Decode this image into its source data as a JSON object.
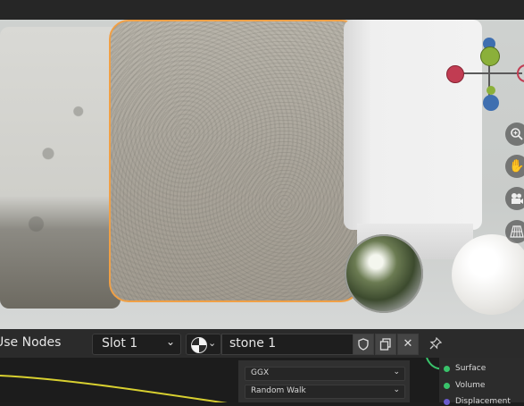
{
  "header": {
    "use_nodes_label": "Use Nodes",
    "slot_label": "Slot 1",
    "material_name": "stone 1"
  },
  "node": {
    "distribution": "GGX",
    "subsurface_method": "Random Walk"
  },
  "output_sockets": [
    "Surface",
    "Volume",
    "Displacement"
  ],
  "colors": {
    "selection_outline": "#f0a046",
    "axis_x": "#c13c52",
    "axis_y": "#8bb03a",
    "axis_z": "#3f6fb0",
    "link_shader": "#39c36b",
    "link_yellow": "#d8d030",
    "socket_purple": "#6a5acd"
  }
}
